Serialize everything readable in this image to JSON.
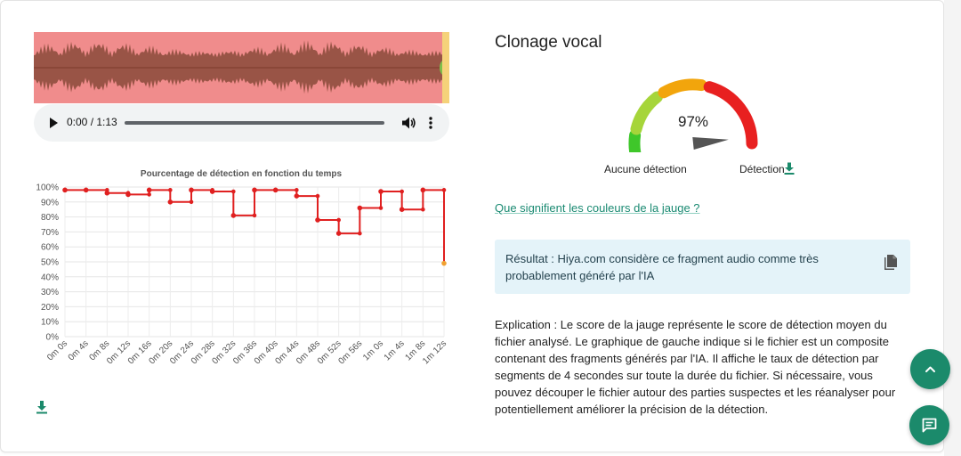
{
  "audio": {
    "time_display": "0:00 / 1:13",
    "waveform_color": "#f08c8c",
    "waveform_wave_color": "#8a4a3a",
    "waveform_end_color": "#f5d27a"
  },
  "chart_data": {
    "type": "line",
    "title": "Pourcentage de détection en fonction du temps",
    "xlabel": "",
    "ylabel": "",
    "ylim": [
      0,
      100
    ],
    "y_ticks": [
      "0%",
      "10%",
      "20%",
      "30%",
      "40%",
      "50%",
      "60%",
      "70%",
      "80%",
      "90%",
      "100%"
    ],
    "categories": [
      "0m 0s",
      "0m 4s",
      "0m 8s",
      "0m 12s",
      "0m 16s",
      "0m 20s",
      "0m 24s",
      "0m 28s",
      "0m 32s",
      "0m 36s",
      "0m 40s",
      "0m 44s",
      "0m 48s",
      "0m 52s",
      "0m 56s",
      "1m 0s",
      "1m 4s",
      "1m 8s",
      "1m 12s"
    ],
    "values": [
      98,
      98,
      96,
      95,
      98,
      90,
      98,
      97,
      81,
      98,
      98,
      94,
      78,
      69,
      86,
      97,
      85,
      98,
      49
    ],
    "step": true,
    "grid": true,
    "legend": "none",
    "line_color": "#e02020"
  },
  "result": {
    "title": "Clonage vocal",
    "gauge_percent": "97%",
    "gauge_value": 97,
    "gauge_left_label": "Aucune détection",
    "gauge_right_label": "Détection",
    "gauge_colors": [
      "#3fc72a",
      "#a6d53a",
      "#f2a50c",
      "#e82020"
    ],
    "colors_link": "Que signifient les couleurs de la jauge ?",
    "summary": "Résultat : Hiya.com considère ce fragment audio comme très probablement généré par l'IA",
    "explanation": "Explication : Le score de la jauge représente le score de détection moyen du fichier analysé. Le graphique de gauche indique si le fichier est un composite contenant des fragments générés par l'IA. Il affiche le taux de détection par segments de 4 secondes sur toute la durée du fichier. Si nécessaire, vous pouvez découper le fichier autour des parties suspectes et les réanalyser pour potentiellement améliorer la précision de la détection."
  },
  "theme": {
    "accent": "#1b8a6b",
    "link": "#1a8a72",
    "result_bg": "#e4f3f9"
  }
}
